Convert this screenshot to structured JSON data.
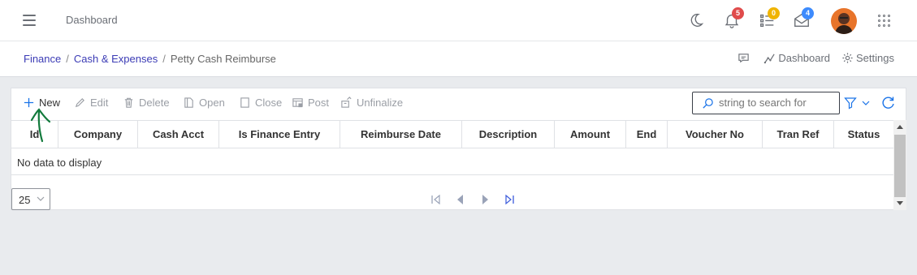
{
  "topbar": {
    "app_title": "Dashboard",
    "icons": [
      "menu-icon",
      "moon-icon",
      "bell-icon",
      "tasks-icon",
      "mail-icon",
      "avatar",
      "apps-grid-icon"
    ],
    "badges": {
      "notifications": "5",
      "tasks": "0",
      "messages": "4"
    },
    "badge_colors": {
      "notifications": "#e04b4b",
      "tasks": "#f0b400",
      "messages": "#3d8bfd"
    }
  },
  "breadcrumb": {
    "items": [
      "Finance",
      "Cash & Expenses"
    ],
    "current": "Petty Cash Reimburse",
    "actions": {
      "dashboard": "Dashboard",
      "settings": "Settings"
    }
  },
  "toolbar": {
    "new": "New",
    "edit": "Edit",
    "delete": "Delete",
    "open": "Open",
    "close": "Close",
    "post": "Post",
    "unfinalize": "Unfinalize",
    "search_placeholder": "string to search for"
  },
  "table": {
    "columns": [
      "Id",
      "Company",
      "Cash Acct",
      "Is Finance Entry",
      "Reimburse Date",
      "Description",
      "Amount",
      "End",
      "Voucher No",
      "Tran Ref",
      "Status"
    ],
    "empty_text": "No data to display"
  },
  "pager": {
    "page_size": "25"
  },
  "colors": {
    "link": "#3b3bb5",
    "accent": "#1a73e8",
    "annotation": "#127a3c"
  }
}
